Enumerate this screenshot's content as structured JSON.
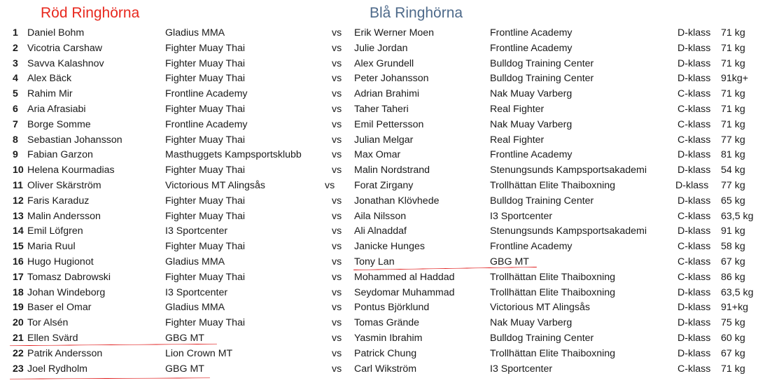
{
  "header": {
    "red_corner": "Röd Ringhörna",
    "blue_corner": "Blå Ringhörna"
  },
  "colors": {
    "red_header": "#e8281e",
    "blue_header": "#4e6a8a",
    "underline": "#e01b1b"
  },
  "bouts": [
    {
      "num": "1",
      "red_name": "Daniel Bohm",
      "red_club": "Gladius MMA",
      "vs": "vs",
      "blue_name": "Erik Werner Moen",
      "blue_club": "Frontline Academy",
      "klass": "D-klass",
      "weight": "71 kg"
    },
    {
      "num": "2",
      "red_name": "Vicotria Carshaw",
      "red_club": "Fighter Muay Thai",
      "vs": "vs",
      "blue_name": "Julie Jordan",
      "blue_club": "Frontline Academy",
      "klass": "D-klass",
      "weight": "71 kg"
    },
    {
      "num": "3",
      "red_name": "Savva Kalashnov",
      "red_club": "Fighter Muay Thai",
      "vs": "vs",
      "blue_name": "Alex Grundell",
      "blue_club": "Bulldog Training Center",
      "klass": "D-klass",
      "weight": "71 kg"
    },
    {
      "num": "4",
      "red_name": "Alex Bäck",
      "red_club": "Fighter Muay Thai",
      "vs": "vs",
      "blue_name": "Peter Johansson",
      "blue_club": "Bulldog Training Center",
      "klass": "D-klass",
      "weight": "91kg+"
    },
    {
      "num": "5",
      "red_name": "Rahim Mir",
      "red_club": "Frontline Academy",
      "vs": "vs",
      "blue_name": "Adrian Brahimi",
      "blue_club": "Nak Muay Varberg",
      "klass": "C-klass",
      "weight": "71 kg"
    },
    {
      "num": "6",
      "red_name": "Aria Afrasiabi",
      "red_club": "Fighter Muay Thai",
      "vs": "vs",
      "blue_name": "Taher Taheri",
      "blue_club": "Real Fighter",
      "klass": "C-klass",
      "weight": "71 kg"
    },
    {
      "num": "7",
      "red_name": "Borge Somme",
      "red_club": "Frontline Academy",
      "vs": "vs",
      "blue_name": "Emil Pettersson",
      "blue_club": "Nak Muay Varberg",
      "klass": "C-klass",
      "weight": "71 kg"
    },
    {
      "num": "8",
      "red_name": "Sebastian Johansson",
      "red_club": "Fighter Muay Thai",
      "vs": "vs",
      "blue_name": "Julian Melgar",
      "blue_club": "Real Fighter",
      "klass": "C-klass",
      "weight": "77 kg"
    },
    {
      "num": "9",
      "red_name": "Fabian Garzon",
      "red_club": "Masthuggets Kampsportsklubb",
      "vs": "vs",
      "blue_name": "Max Omar",
      "blue_club": "Frontline Academy",
      "klass": "D-klass",
      "weight": "81 kg"
    },
    {
      "num": "10",
      "red_name": "Helena Kourmadias",
      "red_club": "Fighter Muay Thai",
      "vs": "vs",
      "blue_name": "Malin Nordstrand",
      "blue_club": "Stenungsunds Kampsportsakademi",
      "klass": "D-klass",
      "weight": "54 kg"
    },
    {
      "num": "11",
      "red_name": "Oliver Skärström",
      "red_club": "Victorious MT Alingsås",
      "vs": "vs",
      "blue_name": "Forat Zirgany",
      "blue_club": "Trollhättan Elite Thaiboxning",
      "klass": "D-klass",
      "weight": "77 kg"
    },
    {
      "num": "12",
      "red_name": "Faris Karaduz",
      "red_club": "Fighter Muay Thai",
      "vs": "vs",
      "blue_name": "Jonathan Klövhede",
      "blue_club": "Bulldog Training Center",
      "klass": "D-klass",
      "weight": "65 kg"
    },
    {
      "num": "13",
      "red_name": "Malin Andersson",
      "red_club": "Fighter Muay Thai",
      "vs": "vs",
      "blue_name": "Aila Nilsson",
      "blue_club": "I3 Sportcenter",
      "klass": "C-klass",
      "weight": "63,5 kg"
    },
    {
      "num": "14",
      "red_name": "Emil Löfgren",
      "red_club": "I3 Sportcenter",
      "vs": "vs",
      "blue_name": "Ali Alnaddaf",
      "blue_club": "Stenungsunds Kampsportsakademi",
      "klass": "D-klass",
      "weight": "91 kg"
    },
    {
      "num": "15",
      "red_name": "Maria Ruul",
      "red_club": "Fighter Muay Thai",
      "vs": "vs",
      "blue_name": "Janicke Hunges",
      "blue_club": "Frontline Academy",
      "klass": "C-klass",
      "weight": "58 kg"
    },
    {
      "num": "16",
      "red_name": "Hugo Hugionot",
      "red_club": "Gladius MMA",
      "vs": "vs",
      "blue_name": "Tony Lan",
      "blue_club": "GBG MT",
      "klass": "C-klass",
      "weight": "67 kg"
    },
    {
      "num": "17",
      "red_name": "Tomasz Dabrowski",
      "red_club": "Fighter Muay Thai",
      "vs": "vs",
      "blue_name": "Mohammed al Haddad",
      "blue_club": "Trollhättan Elite Thaiboxning",
      "klass": "C-klass",
      "weight": "86 kg"
    },
    {
      "num": "18",
      "red_name": "Johan Windeborg",
      "red_club": "I3 Sportcenter",
      "vs": "vs",
      "blue_name": "Seydomar Muhammad",
      "blue_club": "Trollhättan Elite Thaiboxning",
      "klass": "D-klass",
      "weight": "63,5 kg"
    },
    {
      "num": "19",
      "red_name": "Baser el Omar",
      "red_club": "Gladius MMA",
      "vs": "vs",
      "blue_name": "Pontus Björklund",
      "blue_club": "Victorious MT Alingsås",
      "klass": "D-klass",
      "weight": "91+kg"
    },
    {
      "num": "20",
      "red_name": "Tor Alsén",
      "red_club": "Fighter Muay Thai",
      "vs": "vs",
      "blue_name": "Tomas Grände",
      "blue_club": "Nak Muay Varberg",
      "klass": "D-klass",
      "weight": "75 kg"
    },
    {
      "num": "21",
      "red_name": "Ellen Svärd",
      "red_club": "GBG MT",
      "vs": "vs",
      "blue_name": "Yasmin Ibrahim",
      "blue_club": "Bulldog Training Center",
      "klass": "D-klass",
      "weight": "60 kg"
    },
    {
      "num": "22",
      "red_name": "Patrik Andersson",
      "red_club": "Lion Crown MT",
      "vs": "vs",
      "blue_name": "Patrick Chung",
      "blue_club": "Trollhättan Elite Thaiboxning",
      "klass": "D-klass",
      "weight": "67 kg"
    },
    {
      "num": "23",
      "red_name": "Joel Rydholm",
      "red_club": "GBG MT",
      "vs": "vs",
      "blue_name": "Carl Wikström",
      "blue_club": "I3 Sportcenter",
      "klass": "C-klass",
      "weight": "71 kg"
    }
  ]
}
